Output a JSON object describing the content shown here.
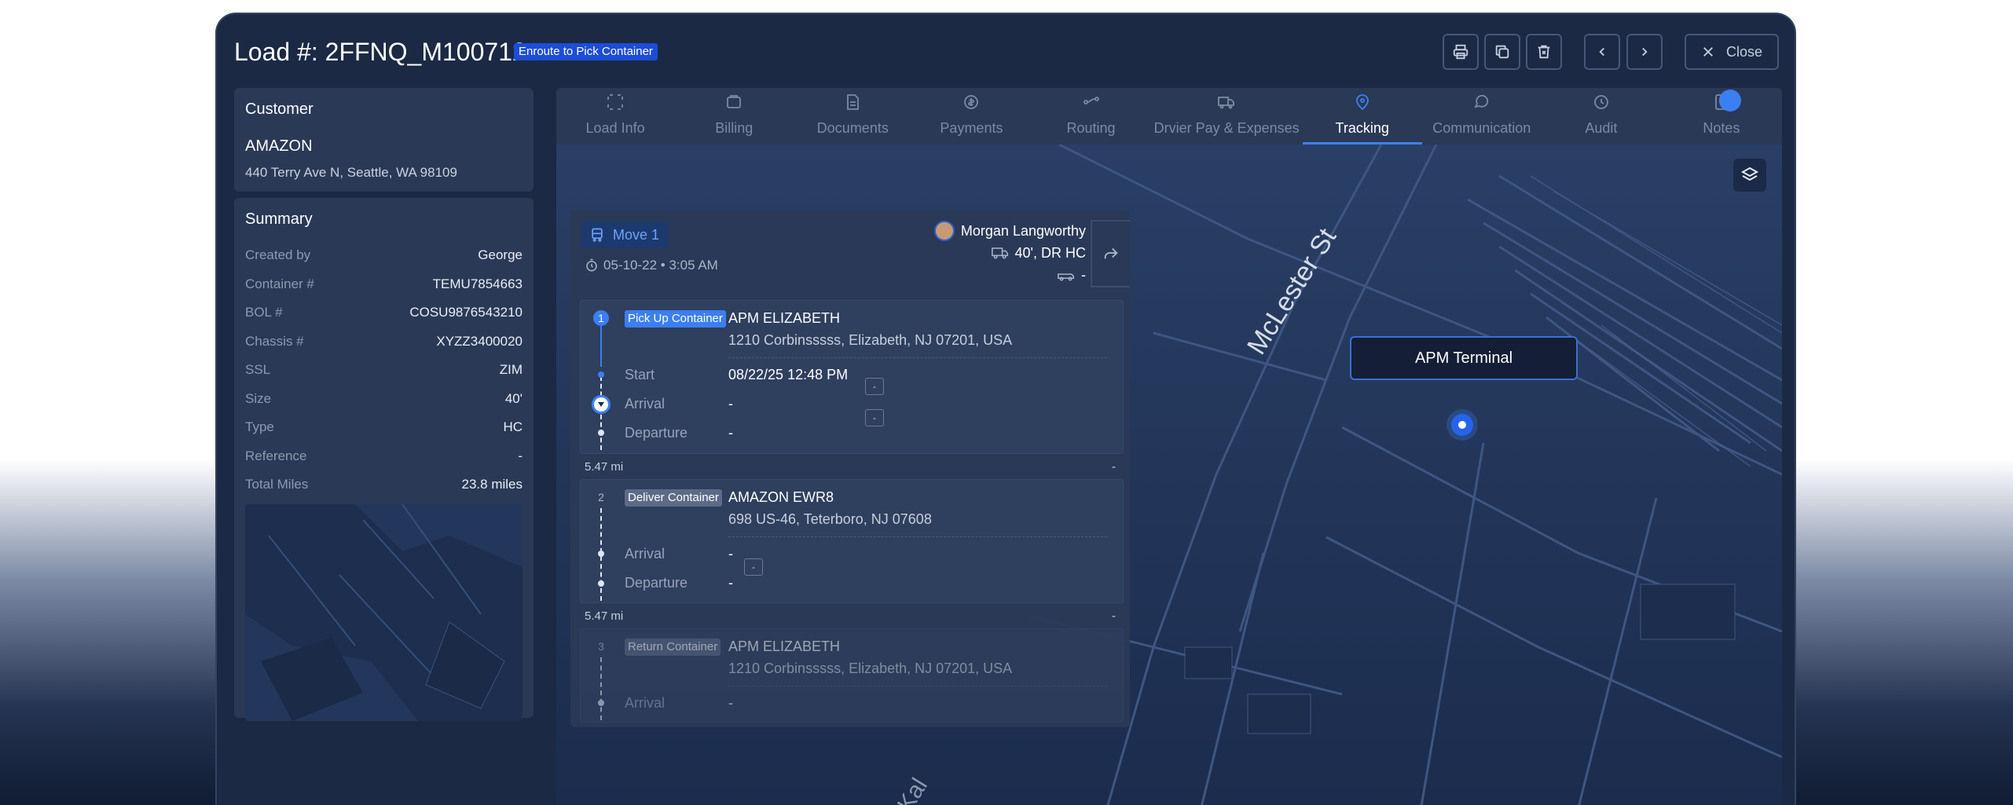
{
  "header": {
    "title": "Load #: 2FFNQ_M100712",
    "status": "Enroute to Pick Container",
    "close_label": "Close"
  },
  "customer": {
    "heading": "Customer",
    "name": "AMAZON",
    "address": "440 Terry Ave N, Seattle, WA 98109"
  },
  "summary": {
    "heading": "Summary",
    "rows": [
      {
        "label": "Created by",
        "value": "George"
      },
      {
        "label": "Container #",
        "value": "TEMU7854663"
      },
      {
        "label": "BOL #",
        "value": "COSU9876543210"
      },
      {
        "label": "Chassis #",
        "value": "XYZZ3400020"
      },
      {
        "label": "SSL",
        "value": "ZIM"
      },
      {
        "label": "Size",
        "value": "40'"
      },
      {
        "label": "Type",
        "value": "HC"
      },
      {
        "label": "Reference",
        "value": "-"
      },
      {
        "label": "Total Miles",
        "value": "23.8 miles"
      }
    ]
  },
  "tabs": [
    {
      "label": "Load Info",
      "icon": "load-info-icon"
    },
    {
      "label": "Billing",
      "icon": "billing-icon"
    },
    {
      "label": "Documents",
      "icon": "documents-icon"
    },
    {
      "label": "Payments",
      "icon": "payments-icon"
    },
    {
      "label": "Routing",
      "icon": "routing-icon"
    },
    {
      "label": "Drvier Pay & Expenses",
      "icon": "driver-pay-icon"
    },
    {
      "label": "Tracking",
      "icon": "tracking-icon",
      "active": true
    },
    {
      "label": "Communication",
      "icon": "communication-icon"
    },
    {
      "label": "Audit",
      "icon": "audit-icon"
    },
    {
      "label": "Notes",
      "icon": "notes-icon"
    }
  ],
  "map": {
    "street": "McLester St",
    "street2": "Kal",
    "terminal_label": "APM Terminal"
  },
  "move": {
    "label": "Move 1",
    "datetime": "05-10-22 • 3:05 AM",
    "driver": "Morgan Langworthy",
    "equipment": "40', DR HC",
    "chassis": "-"
  },
  "stops": [
    {
      "number": "1",
      "tag": "Pick Up Container",
      "name": "APM ELIZABETH",
      "address": "1210 Corbinsssss, Elizabeth, NJ 07201, USA",
      "events": [
        {
          "label": "Start",
          "value": "08/22/25 12:48 PM"
        },
        {
          "label": "Arrival",
          "value": "-"
        },
        {
          "label": "Departure",
          "value": "-"
        }
      ]
    },
    {
      "number": "2",
      "tag": "Deliver Container",
      "name": "AMAZON EWR8",
      "address": "698 US-46, Teterboro, NJ 07608",
      "events": [
        {
          "label": "Arrival",
          "value": "-"
        },
        {
          "label": "Departure",
          "value": "-"
        }
      ]
    },
    {
      "number": "3",
      "tag": "Return Container",
      "name": "APM ELIZABETH",
      "address": "1210 Corbinsssss, Elizabeth, NJ 07201, USA",
      "events": [
        {
          "label": "Arrival",
          "value": "-"
        }
      ]
    }
  ],
  "legs": [
    {
      "miles": "5.47 mi",
      "right": "-"
    },
    {
      "miles": "5.47 mi",
      "right": "-"
    }
  ],
  "colors": {
    "accent": "#3b7ff2",
    "panel": "#2a3956",
    "window": "#1b2944"
  }
}
